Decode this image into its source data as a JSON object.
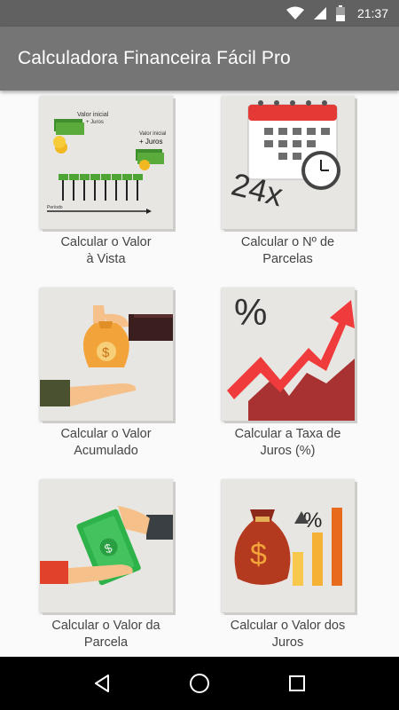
{
  "status_bar": {
    "time": "21:37",
    "icons": [
      "wifi-icon",
      "signal-icon",
      "battery-icon"
    ]
  },
  "app_bar": {
    "title": "Calculadora Financeira Fácil Pro"
  },
  "tiles": [
    {
      "label": "Calcular o Valor\nà Vista",
      "icon": "present-value-chart-icon",
      "illustration_text": [
        "Valor inicial",
        "+ Juros",
        "Valor inicial",
        "+ Juros",
        "Período"
      ]
    },
    {
      "label": "Calcular o Nº de\nParcelas",
      "icon": "calendar-clock-icon",
      "illustration_text": [
        "24x"
      ]
    },
    {
      "label": "Calcular o Valor\nAcumulado",
      "icon": "money-bag-hands-icon",
      "illustration_text": [
        "$"
      ]
    },
    {
      "label": "Calcular a Taxa de\nJuros (%)",
      "icon": "rising-arrow-percent-icon",
      "illustration_text": [
        "%"
      ]
    },
    {
      "label": "Calcular o Valor da\nParcela",
      "icon": "banknote-hands-icon",
      "illustration_text": [
        "$"
      ]
    },
    {
      "label": "Calcular o Valor dos\nJuros",
      "icon": "money-bag-bars-icon",
      "illustration_text": [
        "$",
        "%"
      ]
    }
  ],
  "colors": {
    "status_bar": "#616161",
    "app_bar": "#757575",
    "background": "#fafafa",
    "card": "#e8e6e2",
    "nav_bar": "#000000"
  },
  "nav": {
    "buttons": [
      "back-icon",
      "home-icon",
      "recents-icon"
    ]
  }
}
